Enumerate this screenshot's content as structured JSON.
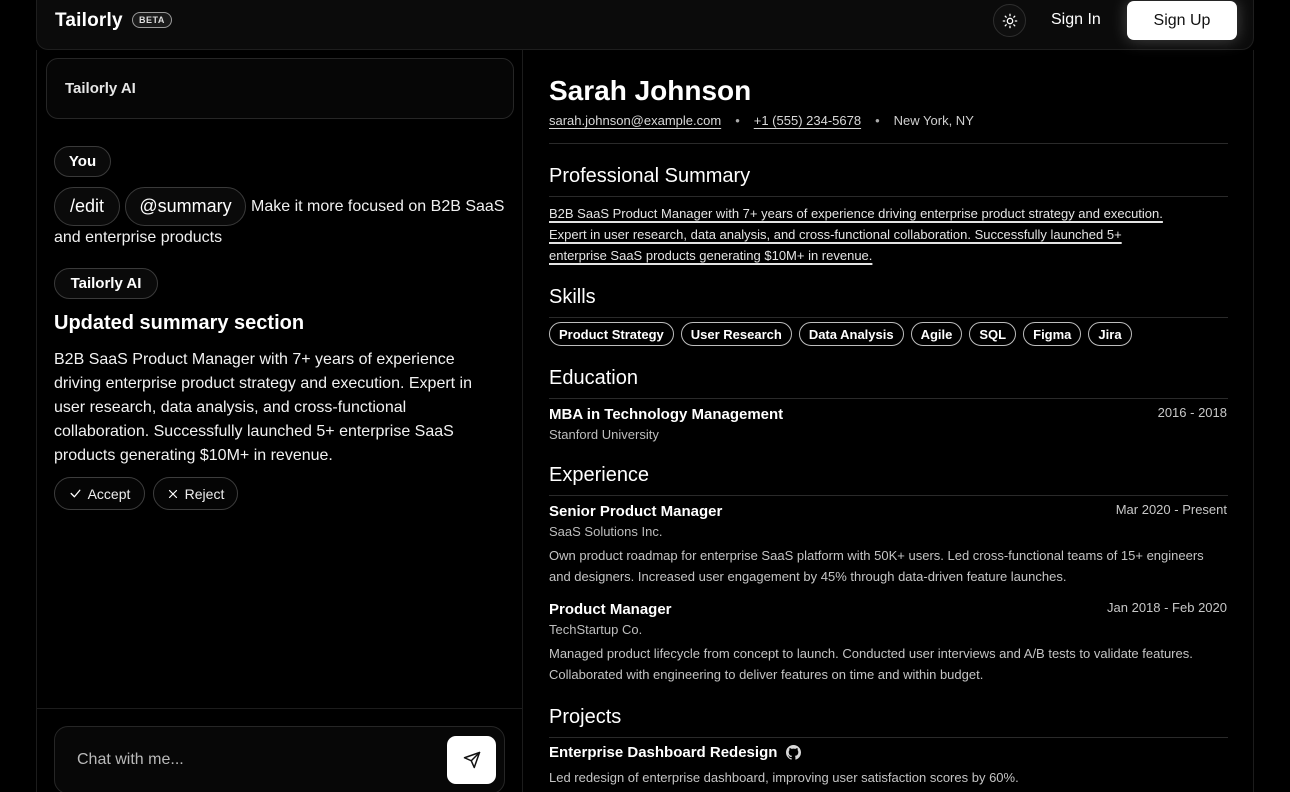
{
  "nav": {
    "brand": "Tailorly",
    "badge": "BETA",
    "theme_icon": "sun-icon",
    "sign_in": "Sign In",
    "sign_up": "Sign Up"
  },
  "chat": {
    "header_title": "Tailorly AI",
    "user_label": "You",
    "commands": [
      "/edit",
      "@summary"
    ],
    "user_message_line1": "Make it more focused on B2B SaaS",
    "user_message_line2": "and enterprise products",
    "ai_label": "Tailorly AI",
    "ai_heading": "Updated summary section",
    "ai_body": "B2B SaaS Product Manager with 7+ years of experience driving enterprise product strategy and execution. Expert in user research, data analysis, and cross-functional collaboration. Successfully launched 5+ enterprise SaaS products generating $10M+ in revenue.",
    "accept": "Accept",
    "reject": "Reject",
    "input_placeholder": "Chat with me..."
  },
  "resume": {
    "name": "Sarah Johnson",
    "email": "sarah.johnson@example.com",
    "phone": "+1 (555) 234-5678",
    "location": "New York, NY",
    "summary_title": "Professional Summary",
    "summary_line1": "B2B SaaS Product Manager with 7+ years of experience driving enterprise product strategy and execution.",
    "summary_line2": "Expert in user research, data analysis, and cross-functional collaboration. Successfully launched 5+",
    "summary_line3": "enterprise SaaS products generating $10M+ in revenue.",
    "skills_title": "Skills",
    "skills": [
      "Product Strategy",
      "User Research",
      "Data Analysis",
      "Agile",
      "SQL",
      "Figma",
      "Jira"
    ],
    "education_title": "Education",
    "education": {
      "degree": "MBA in Technology Management",
      "school": "Stanford University",
      "dates": "2016 - 2018"
    },
    "experience_title": "Experience",
    "experience": [
      {
        "title": "Senior Product Manager",
        "company": "SaaS Solutions Inc.",
        "dates": "Mar 2020 - Present",
        "desc": "Own product roadmap for enterprise SaaS platform with 50K+ users. Led cross-functional teams of 15+ engineers and designers. Increased user engagement by 45% through data-driven feature launches."
      },
      {
        "title": "Product Manager",
        "company": "TechStartup Co.",
        "dates": "Jan 2018 - Feb 2020",
        "desc": "Managed product lifecycle from concept to launch. Conducted user interviews and A/B tests to validate features. Collaborated with engineering to deliver features on time and within budget."
      }
    ],
    "projects_title": "Projects",
    "project": {
      "title": "Enterprise Dashboard Redesign",
      "icon": "github-icon",
      "desc": "Led redesign of enterprise dashboard, improving user satisfaction scores by 60%."
    }
  }
}
